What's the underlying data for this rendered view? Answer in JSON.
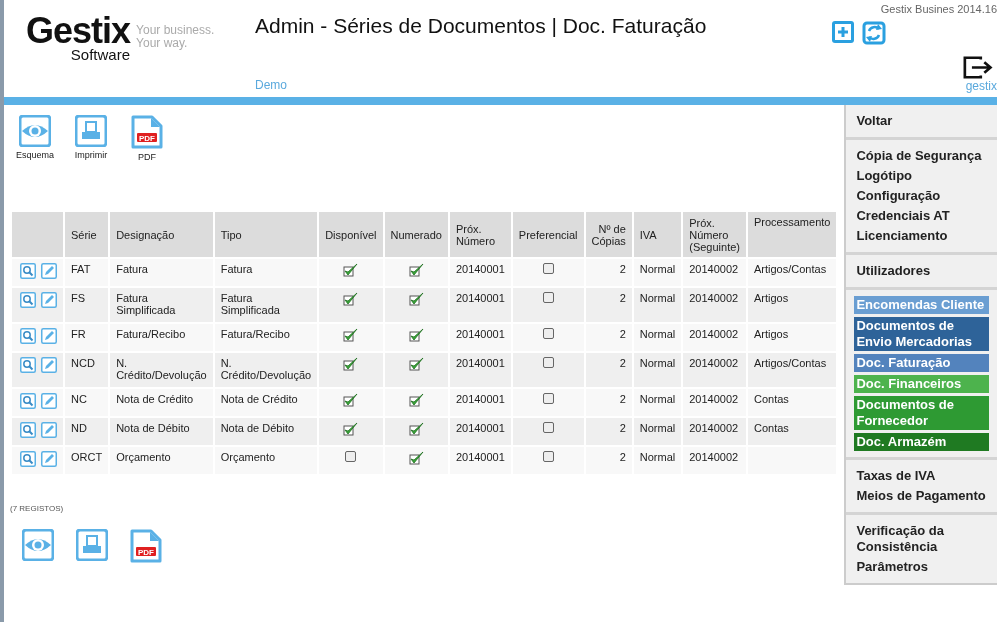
{
  "header": {
    "logo": {
      "name": "Gestix",
      "sub": "Software",
      "tagline_1": "Your business.",
      "tagline_2": "Your way."
    },
    "title": "Admin - Séries de Documentos | Doc. Faturação",
    "company": "Demo",
    "version": "Gestix Busines 2014.16",
    "user": "gestix"
  },
  "toolbar_top": [
    {
      "kind": "eye",
      "label": "Esquema"
    },
    {
      "kind": "printer",
      "label": "Imprimir"
    },
    {
      "kind": "pdf",
      "label": "PDF",
      "badge": "PDF"
    }
  ],
  "table": {
    "columns": [
      "Série",
      "Designação",
      "Tipo",
      "Disponível",
      "Numerado",
      "Próx. Número",
      "Preferencial",
      "Nº de Cópias",
      "IVA",
      "Próx. Número (Seguinte)",
      "Processamento"
    ],
    "rows": [
      {
        "serie": "FAT",
        "designacao": "Fatura",
        "tipo": "Fatura",
        "disponivel": true,
        "numerado": true,
        "prox": "20140001",
        "preferencial": false,
        "copias": "2",
        "iva": "Normal",
        "seguinte": "20140002",
        "processamento": "Artigos/Contas"
      },
      {
        "serie": "FS",
        "designacao": "Fatura Simplificada",
        "tipo": "Fatura Simplificada",
        "disponivel": true,
        "numerado": true,
        "prox": "20140001",
        "preferencial": false,
        "copias": "2",
        "iva": "Normal",
        "seguinte": "20140002",
        "processamento": "Artigos"
      },
      {
        "serie": "FR",
        "designacao": "Fatura/Recibo",
        "tipo": "Fatura/Recibo",
        "disponivel": true,
        "numerado": true,
        "prox": "20140001",
        "preferencial": false,
        "copias": "2",
        "iva": "Normal",
        "seguinte": "20140002",
        "processamento": "Artigos"
      },
      {
        "serie": "NCD",
        "designacao": "N. Crédito/Devolução",
        "tipo": "N. Crédito/Devolução",
        "disponivel": true,
        "numerado": true,
        "prox": "20140001",
        "preferencial": false,
        "copias": "2",
        "iva": "Normal",
        "seguinte": "20140002",
        "processamento": "Artigos/Contas"
      },
      {
        "serie": "NC",
        "designacao": "Nota de Crédito",
        "tipo": "Nota de Crédito",
        "disponivel": true,
        "numerado": true,
        "prox": "20140001",
        "preferencial": false,
        "copias": "2",
        "iva": "Normal",
        "seguinte": "20140002",
        "processamento": "Contas"
      },
      {
        "serie": "ND",
        "designacao": "Nota de Débito",
        "tipo": "Nota de Débito",
        "disponivel": true,
        "numerado": true,
        "prox": "20140001",
        "preferencial": false,
        "copias": "2",
        "iva": "Normal",
        "seguinte": "20140002",
        "processamento": "Contas"
      },
      {
        "serie": "ORCT",
        "designacao": "Orçamento",
        "tipo": "Orçamento",
        "disponivel": false,
        "numerado": true,
        "prox": "20140001",
        "preferencial": false,
        "copias": "2",
        "iva": "Normal",
        "seguinte": "20140002"
      }
    ]
  },
  "record_count": "(7 REGISTOS)",
  "toolbar_bottom": [
    {
      "kind": "eye"
    },
    {
      "kind": "printer"
    },
    {
      "kind": "pdf",
      "badge": "PDF"
    }
  ],
  "sidebar": {
    "groups": [
      {
        "items": [
          {
            "label": "Voltar"
          }
        ]
      },
      {
        "items": [
          {
            "label": "Cópia de Segurança"
          },
          {
            "label": "Logótipo"
          },
          {
            "label": "Configuração"
          },
          {
            "label": "Credenciais AT"
          },
          {
            "label": "Licenciamento"
          }
        ]
      },
      {
        "items": [
          {
            "label": "Utilizadores"
          }
        ]
      },
      {
        "items": [
          {
            "label": "Encomendas Cliente",
            "color": "#6a9ed2"
          },
          {
            "label": "Documentos de Envio Mercadorias",
            "color": "#2e6399"
          },
          {
            "label": "Doc. Faturação",
            "color": "#5383bd"
          },
          {
            "label": "Doc. Financeiros",
            "color": "#4db34d"
          },
          {
            "label": "Documentos de Fornecedor",
            "color": "#2e9a33"
          },
          {
            "label": "Doc. Armazém",
            "color": "#1f7a22"
          }
        ]
      },
      {
        "items": [
          {
            "label": "Taxas de IVA"
          },
          {
            "label": "Meios de Pagamento"
          }
        ]
      },
      {
        "items": [
          {
            "label": "Verificação da Consistência"
          },
          {
            "label": "Parâmetros"
          }
        ]
      }
    ]
  }
}
